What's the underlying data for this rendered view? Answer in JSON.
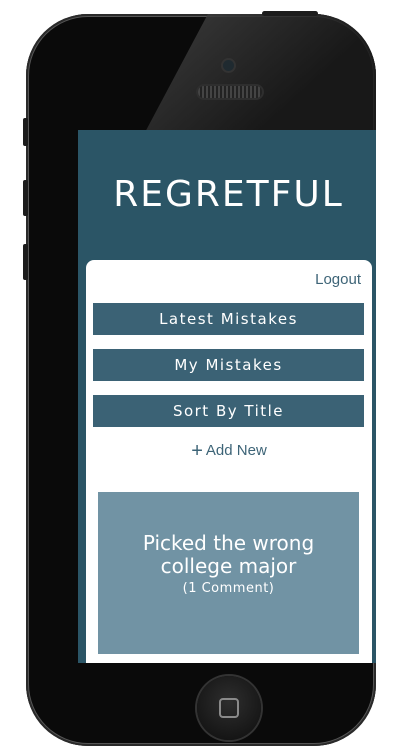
{
  "app": {
    "title": "REGRETFUL"
  },
  "header": {
    "logout_label": "Logout"
  },
  "nav": {
    "items": [
      {
        "label": "Latest Mistakes"
      },
      {
        "label": "My Mistakes"
      },
      {
        "label": "Sort By Title"
      }
    ],
    "add_new_icon": "plus-icon",
    "add_new_label": "Add New"
  },
  "mistakes": [
    {
      "title_line1": "Picked the wrong",
      "title_line2": "college major",
      "comments": "(1 Comment)"
    }
  ],
  "colors": {
    "screen_background": "#2b5566",
    "button_background": "#3b6275",
    "tile_background": "#7193a4",
    "link_text": "#3d6477"
  },
  "device": {
    "home_button_icon": "home-square-icon"
  }
}
